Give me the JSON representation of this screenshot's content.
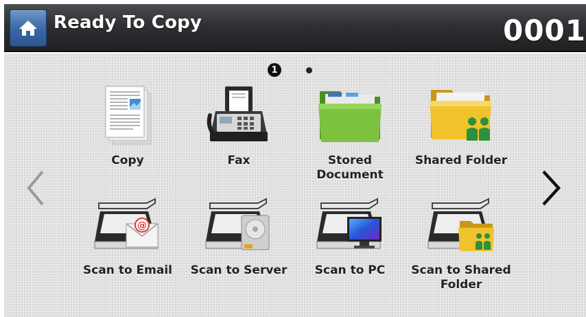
{
  "header": {
    "title": "Ready To Copy",
    "counter": "0001"
  },
  "pager": {
    "current_page": "1",
    "total_pages": 2
  },
  "apps": [
    {
      "label": "Copy",
      "icon": "copy-document-icon"
    },
    {
      "label": "Fax",
      "icon": "fax-machine-icon"
    },
    {
      "label": "Stored Document",
      "icon": "green-folder-icon"
    },
    {
      "label": "Shared Folder",
      "icon": "shared-folder-icon"
    },
    {
      "label": "Scan to Email",
      "icon": "scan-email-icon"
    },
    {
      "label": "Scan to Server",
      "icon": "scan-server-icon"
    },
    {
      "label": "Scan to PC",
      "icon": "scan-pc-icon"
    },
    {
      "label": "Scan to Shared Folder",
      "icon": "scan-shared-folder-icon"
    }
  ],
  "colors": {
    "header_dark": "#1f2022",
    "home_blue": "#3c6aa4",
    "background": "#e6e6e6",
    "folder_green": "#74b43a",
    "folder_yellow": "#f0c32c"
  }
}
